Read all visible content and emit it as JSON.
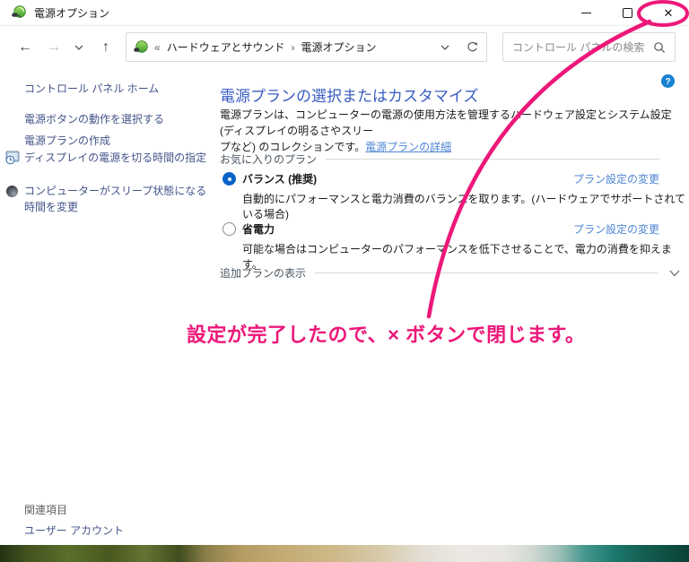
{
  "window": {
    "title": "電源オプション",
    "controls": {
      "minimize": "minimize",
      "maximize": "maximize",
      "close": "close"
    }
  },
  "nav": {
    "address": {
      "root_chevrons": "«",
      "crumb1": "ハードウェアとサウンド",
      "separator": "›",
      "crumb2": "電源オプション"
    },
    "search_placeholder": "コントロール パネルの検索"
  },
  "sidebar": {
    "home": "コントロール パネル ホーム",
    "links": [
      {
        "label": "電源ボタンの動作を選択する"
      },
      {
        "label": "電源プランの作成"
      },
      {
        "label": "ディスプレイの電源を切る時間の指定",
        "icon": "monitor-clock-icon"
      },
      {
        "label": "コンピューターがスリープ状態になる時間を変更",
        "icon": "sleep-moon-icon"
      }
    ],
    "related_header": "関連項目",
    "related_link": "ユーザー アカウント"
  },
  "main": {
    "heading": "電源プランの選択またはカスタマイズ",
    "intro_line1": "電源プランは、コンピューターの電源の使用方法を管理するハードウェア設定とシステム設定 (ディスプレイの明るさやスリー",
    "intro_line2": "プなど) のコレクションです。",
    "intro_link": "電源プランの詳細",
    "favorites_header": "お気に入りのプラン",
    "plans": [
      {
        "name": "バランス (推奨)",
        "selected": true,
        "desc": "自動的にパフォーマンスと電力消費のバランスを取ります。(ハードウェアでサポートされている場合)",
        "link": "プラン設定の変更"
      },
      {
        "name": "省電力",
        "selected": false,
        "desc": "可能な場合はコンピューターのパフォーマンスを低下させることで、電力の消費を抑えます。",
        "link": "プラン設定の変更"
      }
    ],
    "additional_header": "追加プランの表示"
  },
  "annotation": {
    "text": "設定が完了したので、× ボタンで閉じます。",
    "color": "#ED1879"
  },
  "colors": {
    "heading_blue": "#3a5cc0",
    "task_link_blue": "#4e86d4",
    "sidebar_link": "#44548a",
    "radio_blue": "#0a64c8",
    "annotation_pink": "#ED1879"
  }
}
